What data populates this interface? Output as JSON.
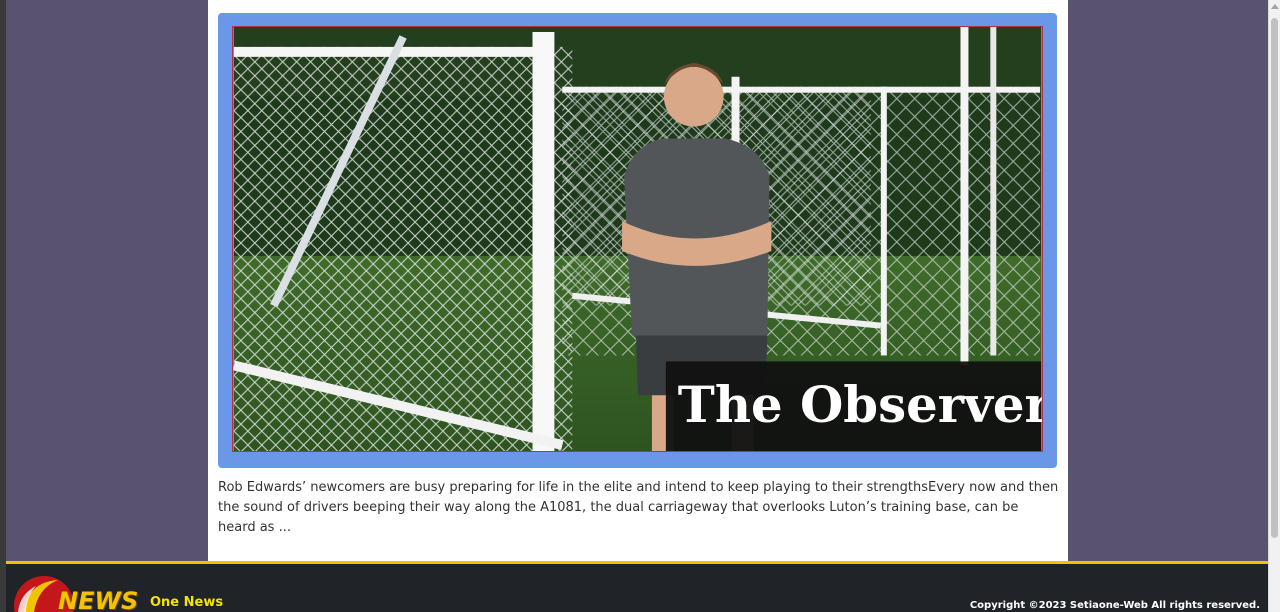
{
  "article": {
    "image": {
      "description": "Man in grey training kit with arms crossed in front of white football goal nets",
      "watermark": "The Observer"
    },
    "excerpt": "Rob Edwards’ newcomers are busy preparing for life in the elite and intend to keep playing to their strengthsEvery now and then the sound of drivers beeping their way along the A1081, the dual carriageway that overlooks Luton’s training base, can be heard as ..."
  },
  "footer": {
    "logo_text": "NEWS",
    "site_name": "One News",
    "copyright": "Copyright ©2023 Setiaone-Web All rights reserved."
  },
  "colors": {
    "page_bg": "#5a5370",
    "frame_accent": "#6a97e8",
    "footer_bg": "#202428",
    "footer_accent": "#f2c300"
  }
}
